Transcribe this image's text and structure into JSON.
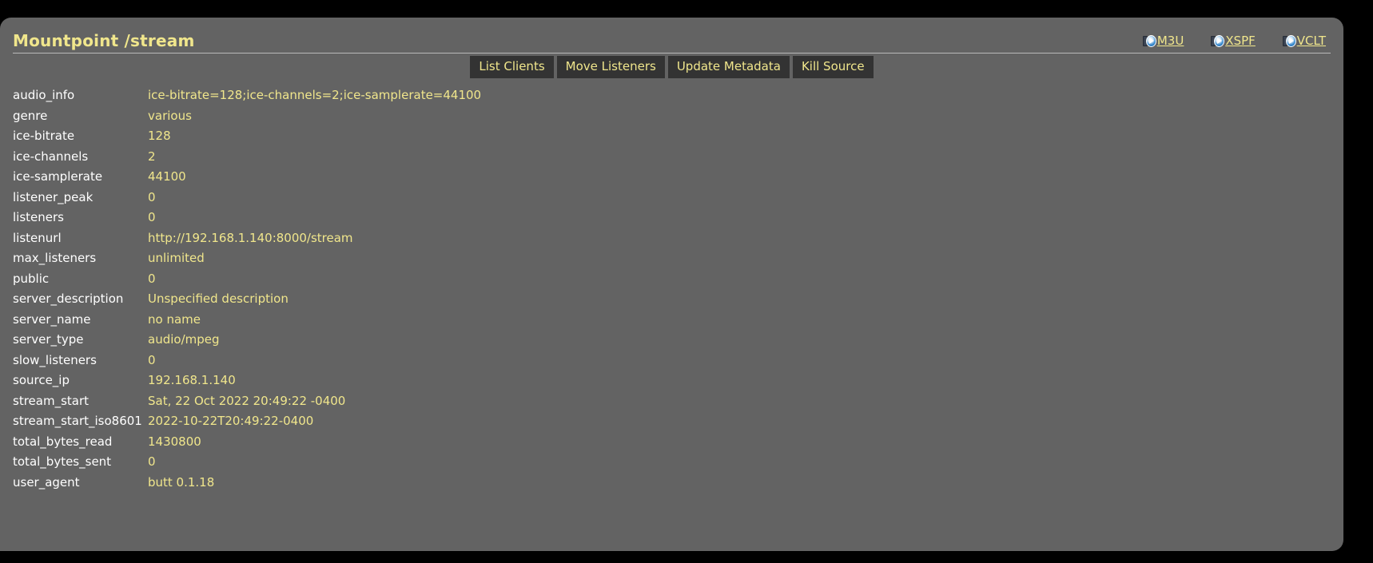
{
  "header": {
    "title": "Mountpoint /stream",
    "playlist_links": [
      {
        "label": "M3U",
        "icon": "media-play-icon"
      },
      {
        "label": "XSPF",
        "icon": "media-play-icon"
      },
      {
        "label": "VCLT",
        "icon": "media-play-icon"
      }
    ]
  },
  "toolbar": {
    "buttons": [
      {
        "label": "List Clients"
      },
      {
        "label": "Move Listeners"
      },
      {
        "label": "Update Metadata"
      },
      {
        "label": "Kill Source"
      }
    ]
  },
  "colors": {
    "page_background": "#000000",
    "panel_background": "#636363",
    "key_text": "#ffffff",
    "value_text": "#f0e68c",
    "accent": "#f0e68c",
    "button_background": "#333333",
    "rule": "#b9b9b9"
  },
  "stats": [
    {
      "key": "audio_info",
      "value": "ice-bitrate=128;ice-channels=2;ice-samplerate=44100"
    },
    {
      "key": "genre",
      "value": "various"
    },
    {
      "key": "ice-bitrate",
      "value": "128"
    },
    {
      "key": "ice-channels",
      "value": "2"
    },
    {
      "key": "ice-samplerate",
      "value": "44100"
    },
    {
      "key": "listener_peak",
      "value": "0"
    },
    {
      "key": "listeners",
      "value": "0"
    },
    {
      "key": "listenurl",
      "value": "http://192.168.1.140:8000/stream"
    },
    {
      "key": "max_listeners",
      "value": "unlimited"
    },
    {
      "key": "public",
      "value": "0"
    },
    {
      "key": "server_description",
      "value": "Unspecified description"
    },
    {
      "key": "server_name",
      "value": "no name"
    },
    {
      "key": "server_type",
      "value": "audio/mpeg"
    },
    {
      "key": "slow_listeners",
      "value": "0"
    },
    {
      "key": "source_ip",
      "value": "192.168.1.140"
    },
    {
      "key": "stream_start",
      "value": "Sat, 22 Oct 2022 20:49:22 -0400"
    },
    {
      "key": "stream_start_iso8601",
      "value": "2022-10-22T20:49:22-0400"
    },
    {
      "key": "total_bytes_read",
      "value": "1430800"
    },
    {
      "key": "total_bytes_sent",
      "value": "0"
    },
    {
      "key": "user_agent",
      "value": "butt 0.1.18"
    }
  ]
}
